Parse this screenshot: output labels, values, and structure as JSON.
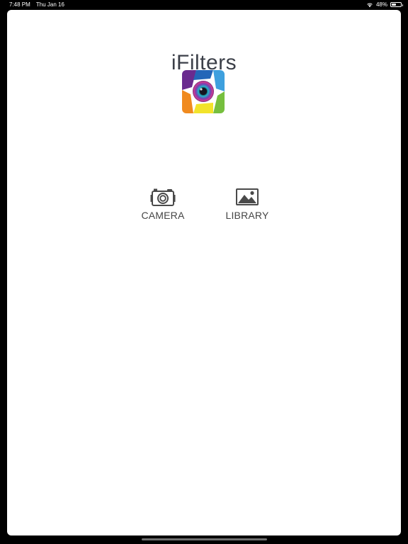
{
  "status_bar": {
    "time": "7:48 PM",
    "date": "Thu Jan 16",
    "battery_percent": "48%",
    "battery_level": 0.48,
    "wifi_icon": "wifi-icon",
    "battery_icon": "battery-icon"
  },
  "header": {
    "title": "iFilters",
    "logo_icon": "ifilters-logo-aperture-eye"
  },
  "actions": {
    "camera": {
      "label": "CAMERA",
      "icon": "camera-icon"
    },
    "library": {
      "label": "LIBRARY",
      "icon": "photo-library-icon"
    }
  },
  "colors": {
    "background": "#000000",
    "sheet": "#ffffff",
    "title_text": "#3b3f48",
    "label_text": "#454545",
    "icon": "#4a4a4a"
  }
}
